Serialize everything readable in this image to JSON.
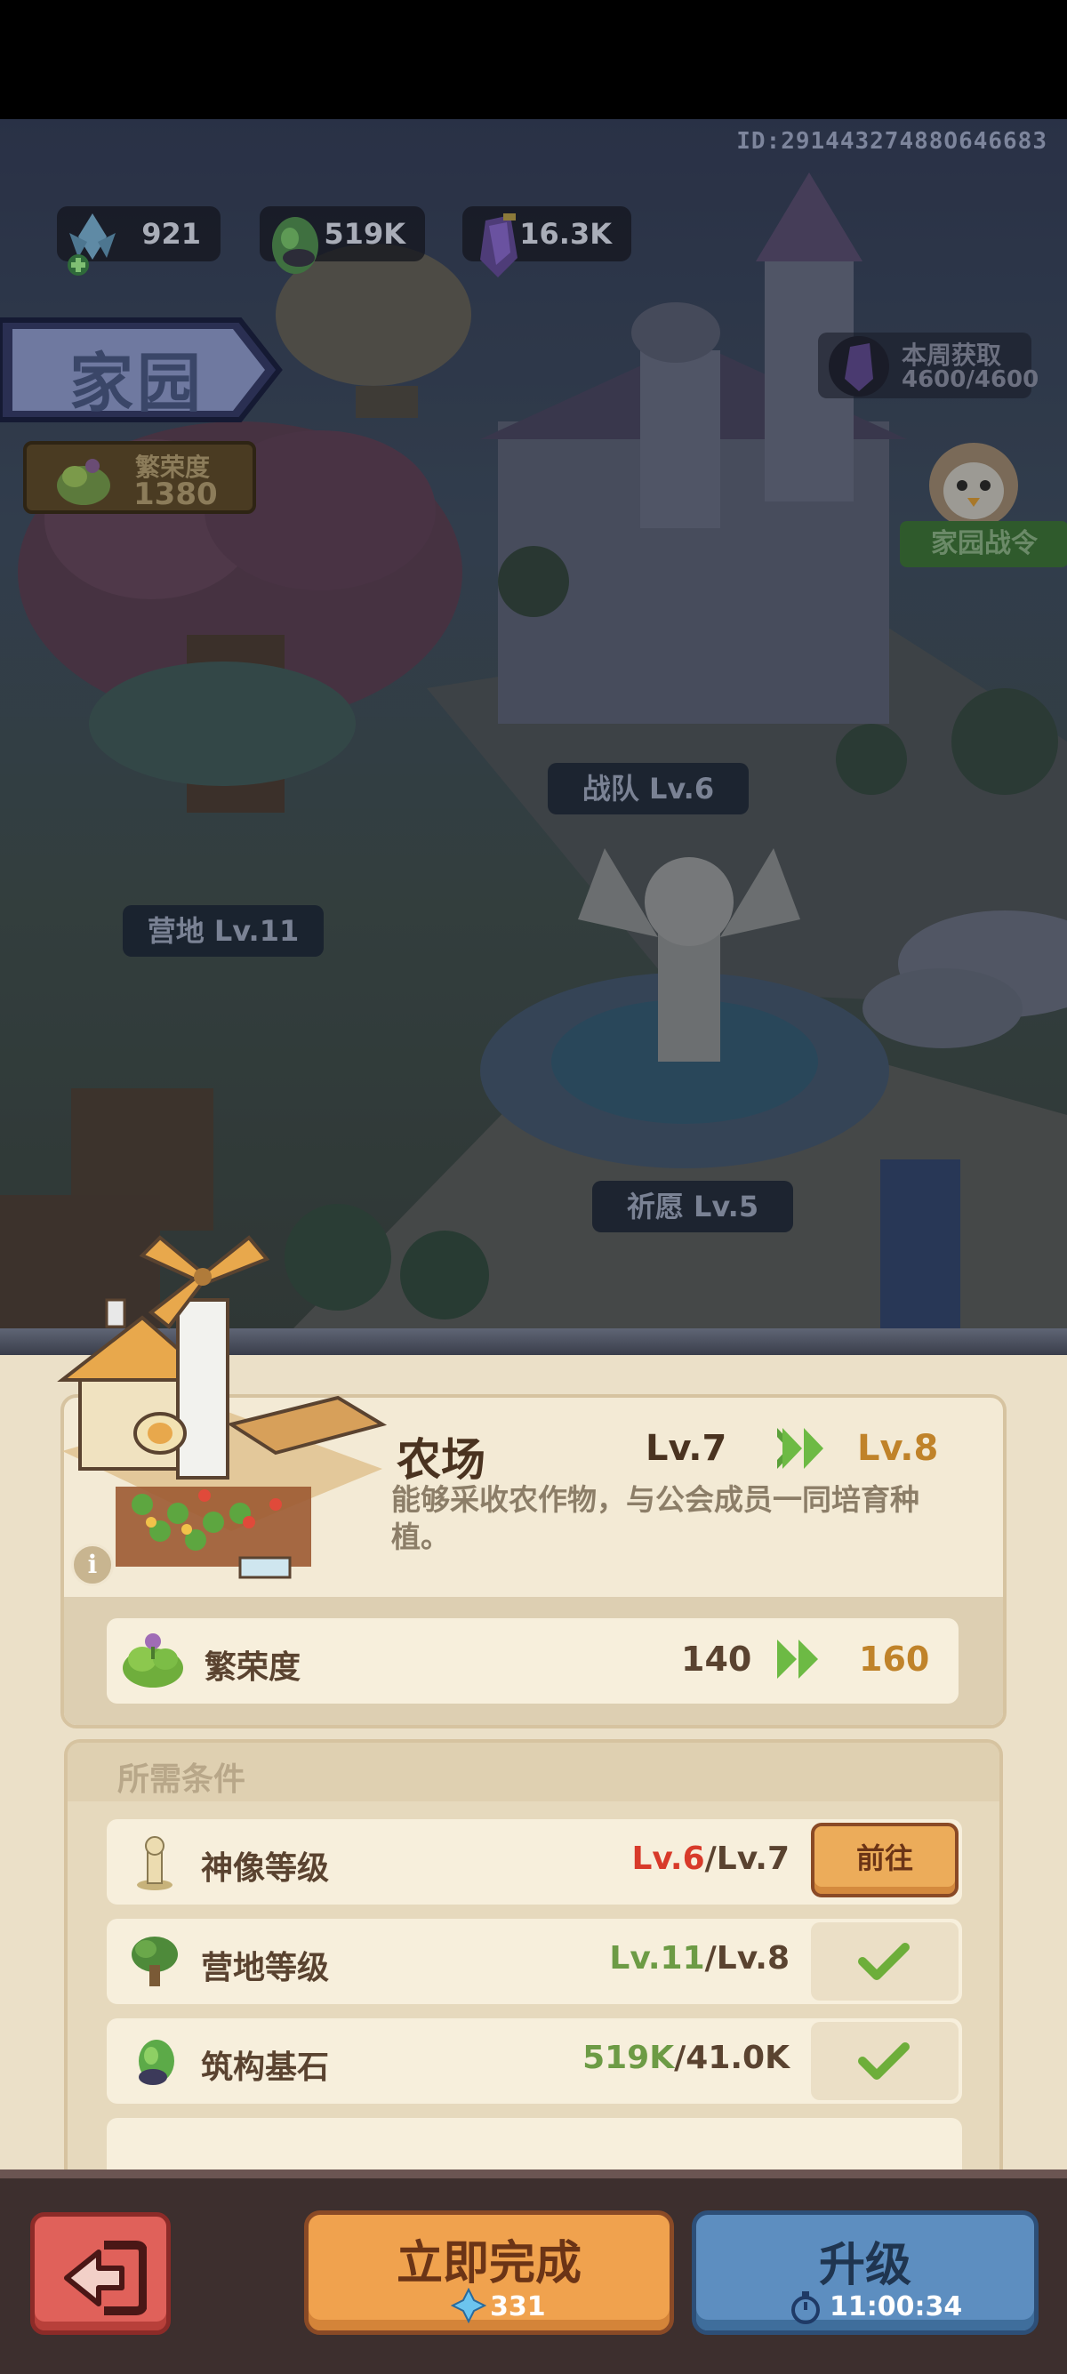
{
  "header": {
    "player_id": "ID:29144327488O646683"
  },
  "resources": [
    {
      "icon": "blue-crystal-icon",
      "value": "921"
    },
    {
      "icon": "green-stone-icon",
      "value": "519K"
    },
    {
      "icon": "purple-crystal-icon",
      "value": "16.3K"
    }
  ],
  "home": {
    "title": "家园",
    "prosperity_label": "繁荣度",
    "prosperity_value": "1380",
    "weekly_label": "本周获取",
    "weekly_value": "4600/4600",
    "pass_label": "家园战令"
  },
  "map_labels": {
    "squad": "战队 Lv.6",
    "camp": "营地 Lv.11",
    "wish": "祈愿 Lv.5"
  },
  "building": {
    "name": "农场",
    "level_from": "Lv.7",
    "level_to": "Lv.8",
    "description": "能够采收农作物，与公会成员一同培育种植。",
    "info_icon": "i",
    "prosperity_label": "繁荣度",
    "prosperity_from": "140",
    "prosperity_to": "160"
  },
  "requirements": {
    "header": "所需条件",
    "rows": [
      {
        "name": "神像等级",
        "current": "Lv.6",
        "required": "/Lv.7",
        "status": "unmet",
        "button": "前往"
      },
      {
        "name": "营地等级",
        "current": "Lv.11",
        "required": "/Lv.8",
        "status": "met"
      },
      {
        "name": "筑构基石",
        "current": "519K",
        "required": "/41.0K",
        "status": "met"
      }
    ]
  },
  "actions": {
    "complete_label": "立即完成",
    "complete_cost": "331",
    "upgrade_label": "升级",
    "upgrade_time": "11:00:34"
  },
  "colors": {
    "unmet": "#d83a2a",
    "met": "#6d9b45",
    "accent": "#c0832a"
  }
}
